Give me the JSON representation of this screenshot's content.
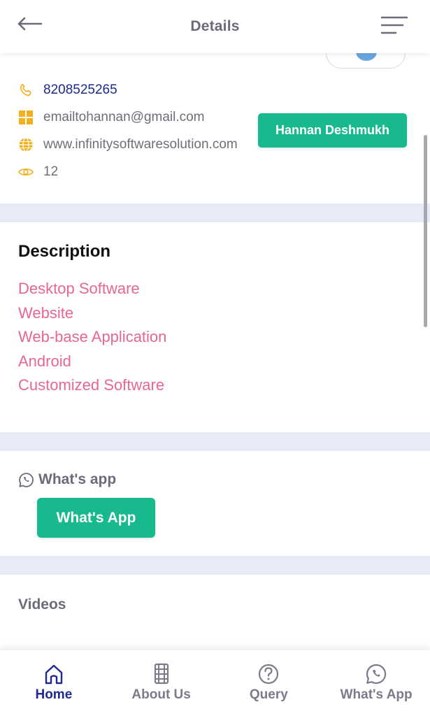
{
  "header": {
    "title": "Details",
    "back_icon": "arrow-left-icon",
    "menu_icon": "hamburger-menu-icon"
  },
  "contact": {
    "phone": "8208525265",
    "email": "emailtohannan@gmail.com",
    "website": "www.infinitysoftwaresolution.com",
    "views": "12",
    "owner_button": "Hannan Deshmukh",
    "icon_color": "#f2b01e"
  },
  "description": {
    "heading": "Description",
    "items": [
      "Desktop Software",
      "Website",
      "Web-base Application",
      "Android",
      "Customized Software"
    ]
  },
  "whatsapp": {
    "label": "What's app",
    "button": "What's App"
  },
  "videos": {
    "heading": "Videos"
  },
  "nav": {
    "items": [
      {
        "label": "Home",
        "icon": "home-icon",
        "active": true
      },
      {
        "label": "About Us",
        "icon": "building-icon",
        "active": false
      },
      {
        "label": "Query",
        "icon": "question-icon",
        "active": false
      },
      {
        "label": "What's App",
        "icon": "whatsapp-icon",
        "active": false
      }
    ]
  },
  "colors": {
    "accent_green": "#18b98e",
    "link_pink": "#e8678f",
    "nav_active": "#1f2a8e",
    "phone_blue": "#1d2a8c",
    "section_gap": "#e8ebf5"
  }
}
